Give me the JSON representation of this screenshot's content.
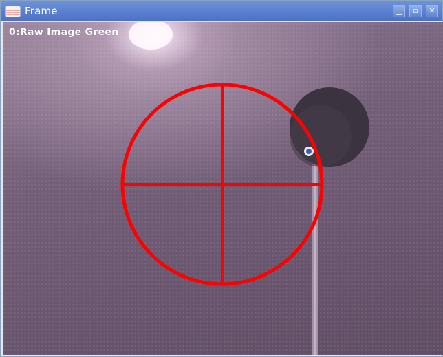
{
  "window": {
    "title": "Frame",
    "app_icon": "image-viewer-icon",
    "controls": {
      "minimize_icon": "minimize-icon",
      "minimize_glyph": "▁",
      "maximize_icon": "maximize-icon",
      "maximize_glyph": "▫",
      "close_icon": "close-icon",
      "close_glyph": "✕"
    }
  },
  "frame": {
    "overlay_text": "0:Raw Image Green",
    "crosshair_color": "#ff0000",
    "colors": {
      "titlebar": "#5a7fcf",
      "background_tint": "#735e78",
      "label_text": "#ffffff"
    }
  }
}
